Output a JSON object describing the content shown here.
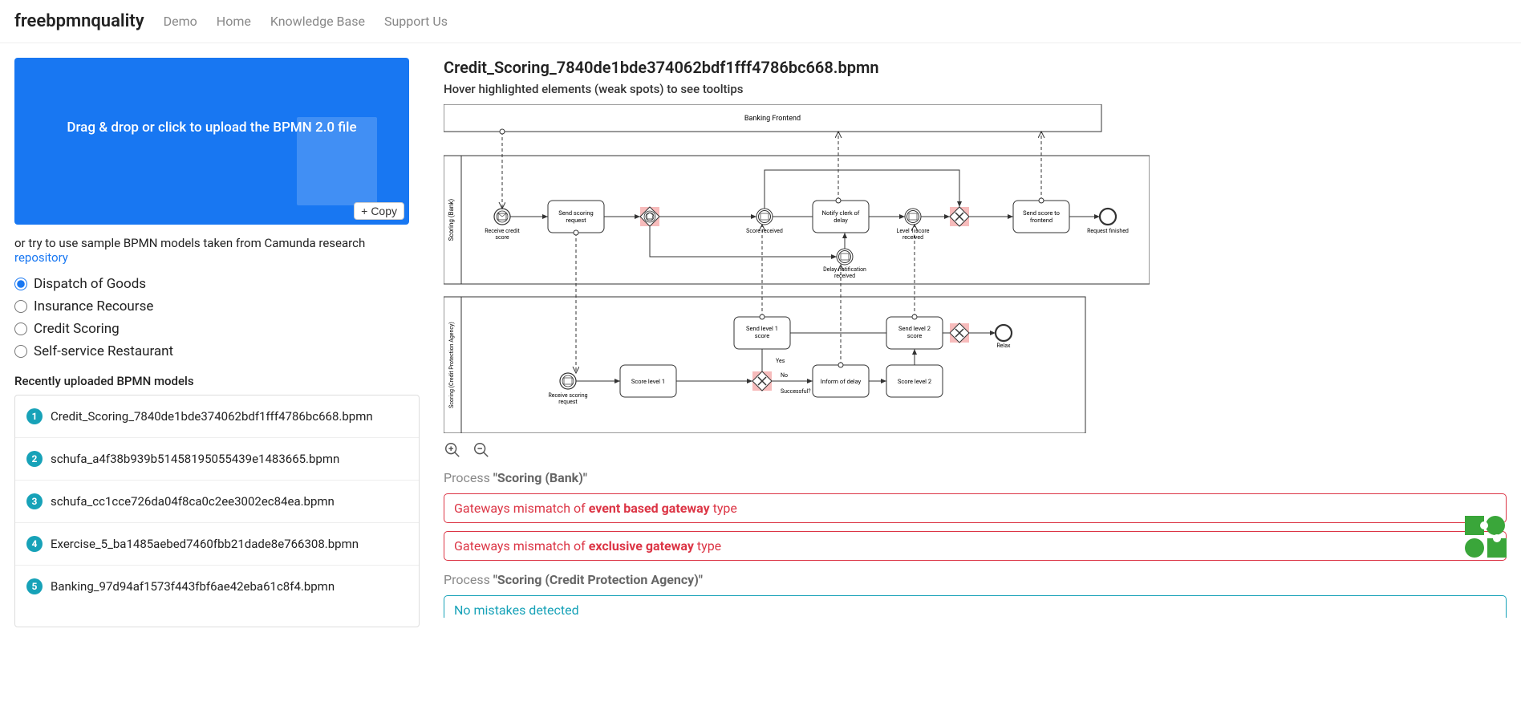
{
  "nav": {
    "brand": "freebpmnquality",
    "links": [
      "Demo",
      "Home",
      "Knowledge Base",
      "Support Us"
    ]
  },
  "dropzone": {
    "text": "Drag & drop or click to upload the BPMN 2.0 file",
    "copy": "Copy"
  },
  "hint": {
    "prefix": "or try to use sample BPMN models taken from Camunda research ",
    "link": "repository"
  },
  "samples": [
    {
      "label": "Dispatch of Goods",
      "checked": true
    },
    {
      "label": "Insurance Recourse",
      "checked": false
    },
    {
      "label": "Credit Scoring",
      "checked": false
    },
    {
      "label": "Self-service Restaurant",
      "checked": false
    }
  ],
  "recent": {
    "label": "Recently uploaded BPMN models",
    "items": [
      "Credit_Scoring_7840de1bde374062bdf1fff4786bc668.bpmn",
      "schufa_a4f38b939b51458195055439e1483665.bpmn",
      "schufa_cc1cce726da04f8ca0c2ee3002ec84ea.bpmn",
      "Exercise_5_ba1485aebed7460fbb21dade8e766308.bpmn",
      "Banking_97d94af1573f443fbf6ae42eba61c8f4.bpmn"
    ]
  },
  "file": {
    "title": "Credit_Scoring_7840de1bde374062bdf1fff4786bc668.bpmn",
    "subtitle": "Hover highlighted elements (weak spots) to see tooltips"
  },
  "diagram": {
    "pool_top": "Banking Frontend",
    "lane_bank": "Scoring (Bank)",
    "lane_agency": "Scoring (Credit Protection Agency)",
    "tasks": {
      "receive_credit": "Receive credit score",
      "send_request": "Send scoring request",
      "score_received": "Score received",
      "notify_clerk": "Notify clerk of delay",
      "level1_received": "Level 1 score received",
      "send_score_frontend": "Send score to frontend",
      "request_finished": "Request finished",
      "delay_notif": "Delay notification received",
      "receive_scoring_request": "Receive scoring request",
      "score_level1": "Score level 1",
      "send_level1": "Send level 1 score",
      "score_level2": "Score level 2",
      "send_level2": "Send level 2 score",
      "inform_delay": "Inform of delay",
      "relax": "Relax",
      "yes": "Yes",
      "no": "No",
      "successful": "Successful?"
    }
  },
  "results": {
    "process1_label": "Process ",
    "process1_name": "\"Scoring (Bank)\"",
    "process2_label": "Process ",
    "process2_name": "\"Scoring (Credit Protection Agency)\"",
    "issue1_prefix": "Gateways mismatch of ",
    "issue1_strong": "event based gateway",
    "issue1_suffix": " type",
    "issue2_prefix": "Gateways mismatch of ",
    "issue2_strong": "exclusive gateway",
    "issue2_suffix": " type",
    "info": "No mistakes detected"
  }
}
